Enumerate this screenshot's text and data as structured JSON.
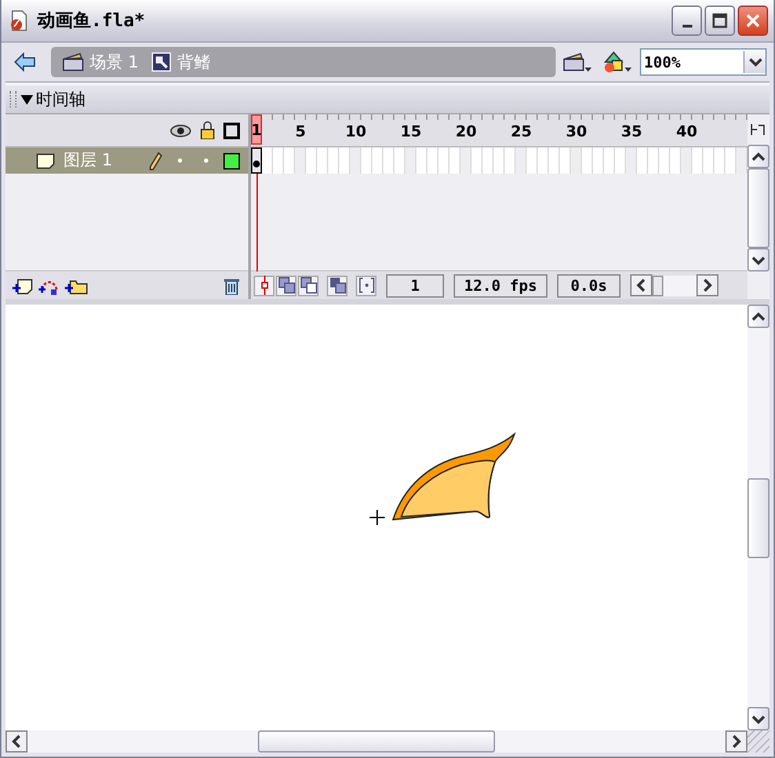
{
  "window": {
    "title": "动画鱼.fla*"
  },
  "breadcrumb": [
    {
      "label": "场景 1",
      "kind": "scene"
    },
    {
      "label": "背鳍",
      "kind": "symbol"
    }
  ],
  "zoom": {
    "value": "100%"
  },
  "timeline": {
    "title": "时间轴",
    "expanded": true,
    "frame_numbers": [
      "1",
      "5",
      "10",
      "15",
      "20",
      "25",
      "30",
      "35",
      "40"
    ],
    "layers": [
      {
        "name": "图层 1",
        "selected": true
      }
    ],
    "status": {
      "frame": "1",
      "fps": "12.0 fps",
      "time": "0.0s"
    }
  }
}
